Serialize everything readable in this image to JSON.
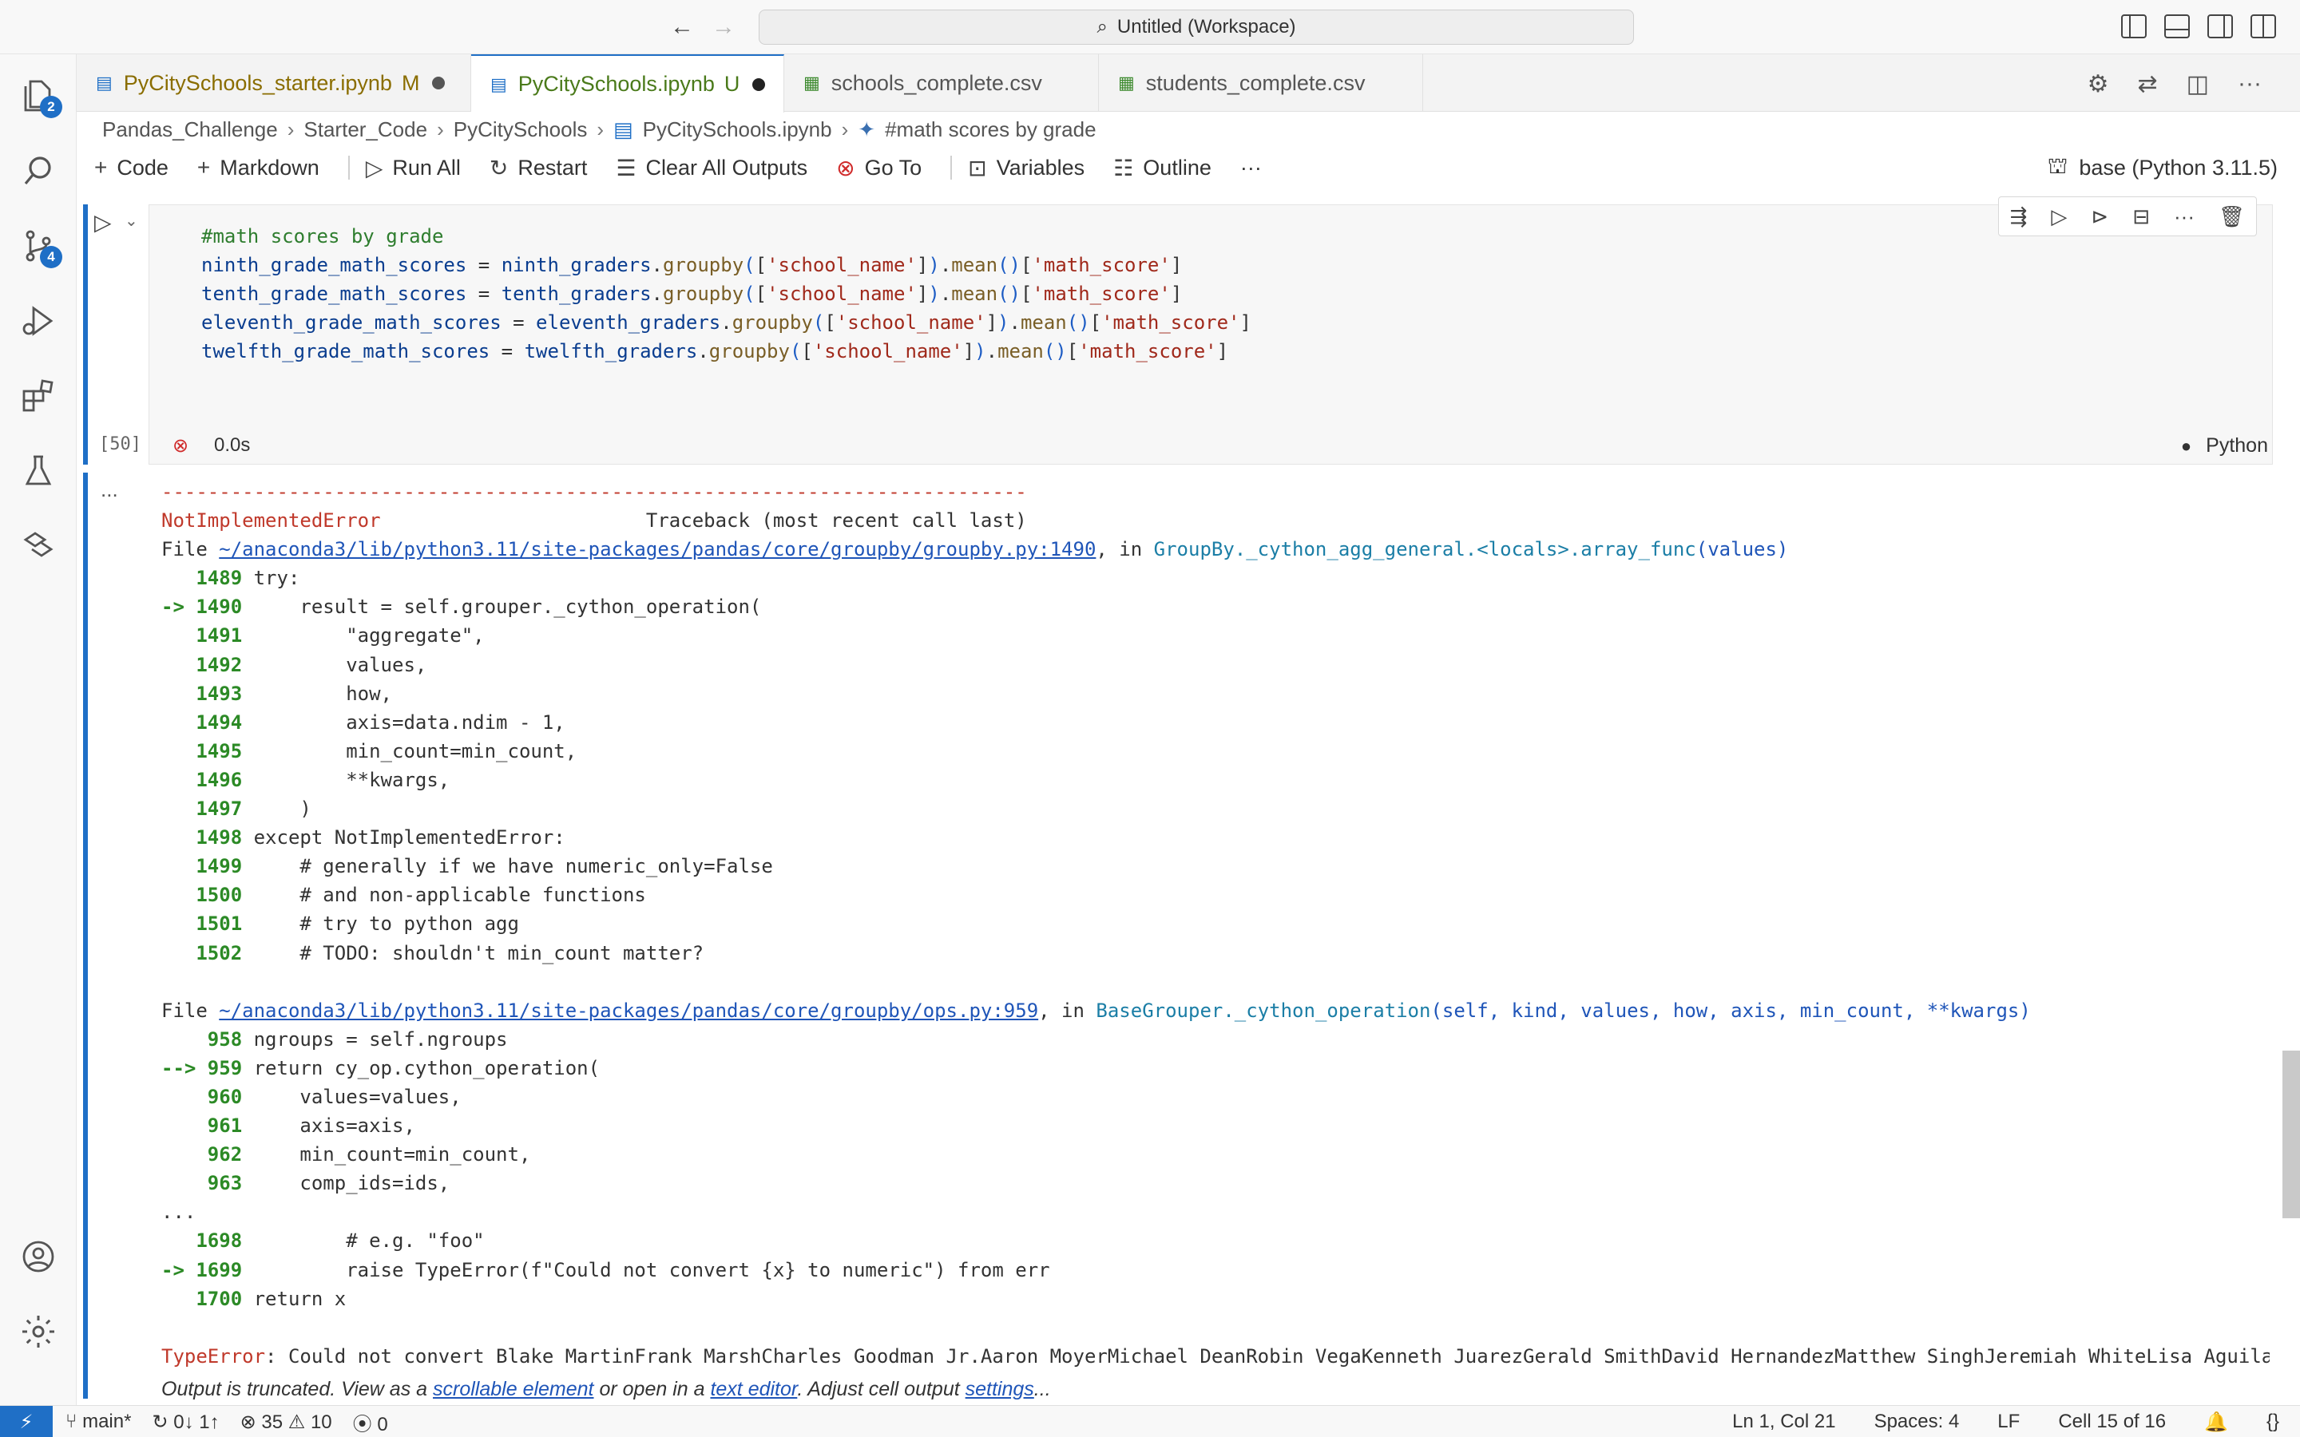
{
  "titlebar": {
    "search_text": "Untitled (Workspace)"
  },
  "activity": {
    "explorer_badge": "2",
    "scm_badge": "4"
  },
  "tabs": [
    {
      "label": "PyCitySchools_starter.ipynb",
      "status": "M"
    },
    {
      "label": "PyCitySchools.ipynb",
      "status": "U"
    },
    {
      "label": "schools_complete.csv",
      "status": ""
    },
    {
      "label": "students_complete.csv",
      "status": ""
    }
  ],
  "breadcrumb": [
    "Pandas_Challenge",
    "Starter_Code",
    "PyCitySchools",
    "PyCitySchools.ipynb",
    "#math scores by grade"
  ],
  "toolbar": {
    "code": "Code",
    "markdown": "Markdown",
    "run_all": "Run All",
    "restart": "Restart",
    "clear_all_outputs": "Clear All Outputs",
    "go_to": "Go To",
    "variables": "Variables",
    "outline": "Outline",
    "more": "···",
    "kernel": "base (Python 3.11.5)"
  },
  "cell": {
    "comment": "#math scores by grade",
    "lines": [
      {
        "var": "ninth_grade_math_scores",
        "src": "ninth_graders"
      },
      {
        "var": "tenth_grade_math_scores",
        "src": "tenth_graders"
      },
      {
        "var": "eleventh_grade_math_scores",
        "src": "eleventh_graders"
      },
      {
        "var": "twelfth_grade_math_scores",
        "src": "twelfth_graders"
      }
    ],
    "groupby_key": "'school_name'",
    "column": "'math_score'",
    "exec_count": "[50]",
    "exec_time": "0.0s",
    "language": "Python"
  },
  "output": {
    "dots": "...",
    "dashes": "---------------------------------------------------------------------------",
    "error1_name": "NotImplementedError",
    "traceback_header": "Traceback (most recent call last)",
    "file1_path": "~/anaconda3/lib/python3.11/site-packages/pandas/core/groupby/groupby.py:1490",
    "file1_func": "GroupBy._cython_agg_general.<locals>.array_func",
    "file1_args": "values",
    "block1": [
      {
        "no": "1489",
        "arrow": false,
        "code": "try:"
      },
      {
        "no": "1490",
        "arrow": true,
        "code": "    result = self.grouper._cython_operation("
      },
      {
        "no": "1491",
        "arrow": false,
        "code": "        \"aggregate\","
      },
      {
        "no": "1492",
        "arrow": false,
        "code": "        values,"
      },
      {
        "no": "1493",
        "arrow": false,
        "code": "        how,"
      },
      {
        "no": "1494",
        "arrow": false,
        "code": "        axis=data.ndim - 1,"
      },
      {
        "no": "1495",
        "arrow": false,
        "code": "        min_count=min_count,"
      },
      {
        "no": "1496",
        "arrow": false,
        "code": "        **kwargs,"
      },
      {
        "no": "1497",
        "arrow": false,
        "code": "    )"
      },
      {
        "no": "1498",
        "arrow": false,
        "code": "except NotImplementedError:"
      },
      {
        "no": "1499",
        "arrow": false,
        "code": "    # generally if we have numeric_only=False"
      },
      {
        "no": "1500",
        "arrow": false,
        "code": "    # and non-applicable functions"
      },
      {
        "no": "1501",
        "arrow": false,
        "code": "    # try to python agg"
      },
      {
        "no": "1502",
        "arrow": false,
        "code": "    # TODO: shouldn't min_count matter?"
      }
    ],
    "file2_path": "~/anaconda3/lib/python3.11/site-packages/pandas/core/groupby/ops.py:959",
    "file2_func": "BaseGrouper._cython_operation",
    "file2_args": "self, kind, values, how, axis, min_count, **kwargs",
    "block2": [
      {
        "no": "958",
        "arrow": false,
        "code": "ngroups = self.ngroups"
      },
      {
        "no": "959",
        "arrow": true,
        "code": "return cy_op.cython_operation("
      },
      {
        "no": "960",
        "arrow": false,
        "code": "    values=values,"
      },
      {
        "no": "961",
        "arrow": false,
        "code": "    axis=axis,"
      },
      {
        "no": "962",
        "arrow": false,
        "code": "    min_count=min_count,"
      },
      {
        "no": "963",
        "arrow": false,
        "code": "    comp_ids=ids,"
      }
    ],
    "ellipsis": "...",
    "block3": [
      {
        "no": "1698",
        "arrow": false,
        "code": "        # e.g. \"foo\""
      },
      {
        "no": "1699",
        "arrow": true,
        "code": "        raise TypeError(f\"Could not convert {x} to numeric\") from err"
      },
      {
        "no": "1700",
        "arrow": false,
        "code": "return x"
      }
    ],
    "error2_name": "TypeError",
    "error2_msg": ": Could not convert Blake MartinFrank MarshCharles Goodman Jr.Aaron MoyerMichael DeanRobin VegaKenneth JuarezGerald SmithDavid HernandezMatthew SinghJeremiah WhiteLisa Aguilar"
  },
  "truncated": {
    "t1": "Output is truncated. View as a ",
    "link1": "scrollable element",
    "t2": " or open in a ",
    "link2": "text editor",
    "t3": ". Adjust cell output ",
    "link3": "settings",
    "t4": "..."
  },
  "statusbar": {
    "branch": "main*",
    "sync": "0↓ 1↑",
    "errors": "35",
    "warnings": "10",
    "ports": "0",
    "position": "Ln 1, Col 21",
    "spaces": "Spaces: 4",
    "eol": "LF",
    "cell": "Cell 15 of 16"
  },
  "colors": {
    "accent": "#1f6fc6",
    "error": "#c0392b",
    "line_number": "#2c8a26"
  }
}
